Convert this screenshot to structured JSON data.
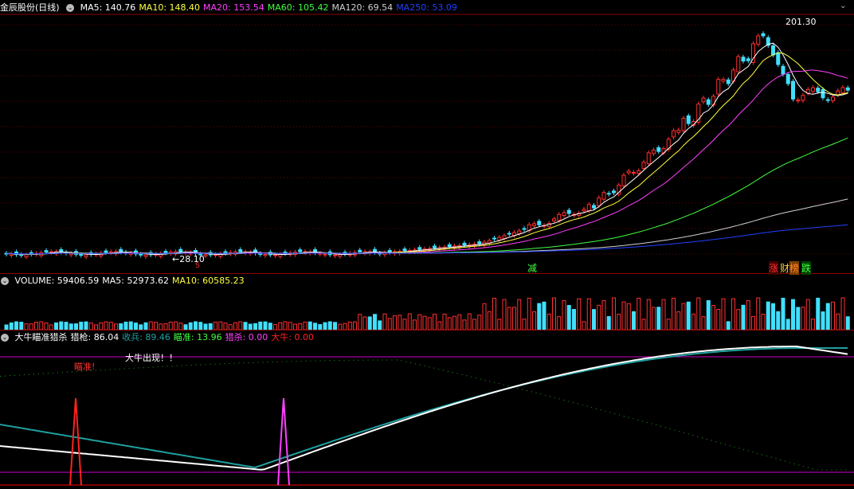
{
  "main_panel": {
    "title": "金辰股份(日线)",
    "ma_labels": [
      {
        "text": "MA5: 140.76",
        "color": "#ffffff"
      },
      {
        "text": "MA10: 148.40",
        "color": "#ffff40"
      },
      {
        "text": "MA20: 153.54",
        "color": "#ff40ff"
      },
      {
        "text": "MA60: 105.42",
        "color": "#40ff40"
      },
      {
        "text": "MA120: 69.54",
        "color": "#d0d0d0"
      },
      {
        "text": "MA250: 53.09",
        "color": "#2040ff"
      }
    ],
    "high_label": "201.30",
    "low_label": "←28.10",
    "markers": {
      "jian": "减",
      "zhang": "涨",
      "cai": "财",
      "bang": "榜",
      "die": "跌",
      "s": "S"
    }
  },
  "volume_panel": {
    "labels": [
      {
        "text": "VOLUME: 59406.59",
        "color": "#ffffff"
      },
      {
        "text": "MA5: 52973.62",
        "color": "#ffffff"
      },
      {
        "text": "MA10: 60585.23",
        "color": "#ffff40"
      }
    ]
  },
  "indicator_panel": {
    "labels": [
      {
        "text": "大牛瞄准猎杀",
        "color": "#ffffff"
      },
      {
        "text": "猎枪: 86.04",
        "color": "#ffffff"
      },
      {
        "text": "收兵: 89.46",
        "color": "#20a0a0"
      },
      {
        "text": "瞄准: 13.96",
        "color": "#40ff40"
      },
      {
        "text": "猎杀: 0.00",
        "color": "#ff40ff"
      },
      {
        "text": "大牛: 0.00",
        "color": "#ff2020"
      }
    ],
    "aim_text": "瞄准!",
    "bull_text": "大牛出现！！"
  }
}
